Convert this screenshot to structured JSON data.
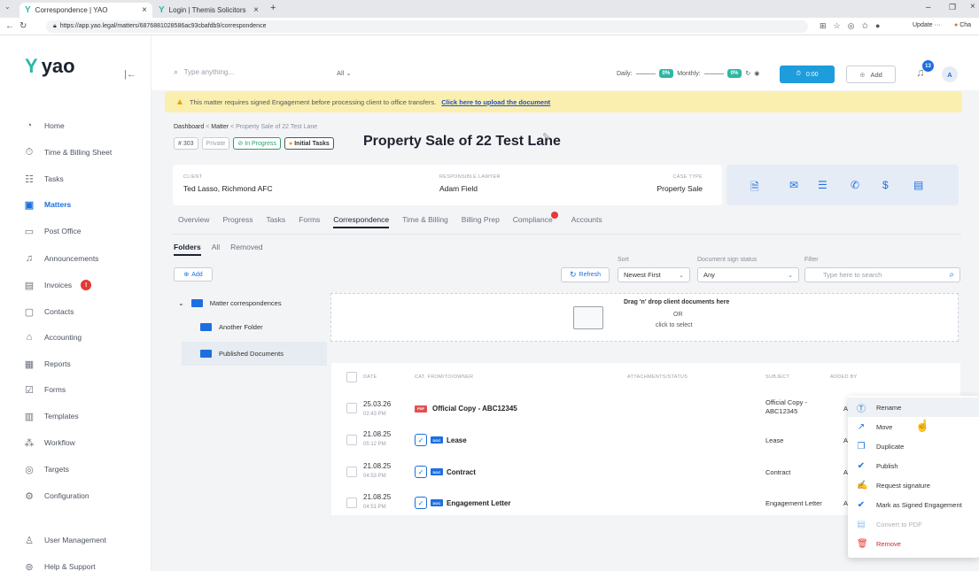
{
  "browser": {
    "tabs": [
      {
        "label": "Correspondence | YAO"
      },
      {
        "label": "Login | Themis Solicitors"
      }
    ],
    "url": "https://app.yao.legal/matters/6876881028586ac93cbafdb9/correspondence",
    "update_label": "Update",
    "profile_label": "Cha"
  },
  "sidebar": {
    "logo": "yao",
    "items": [
      {
        "label": "Home"
      },
      {
        "label": "Time & Billing Sheet"
      },
      {
        "label": "Tasks"
      },
      {
        "label": "Matters"
      },
      {
        "label": "Post Office"
      },
      {
        "label": "Announcements"
      },
      {
        "label": "Invoices",
        "badge": "!"
      },
      {
        "label": "Contacts"
      },
      {
        "label": "Accounting"
      },
      {
        "label": "Reports"
      },
      {
        "label": "Forms"
      },
      {
        "label": "Templates"
      },
      {
        "label": "Workflow"
      },
      {
        "label": "Targets"
      },
      {
        "label": "Configuration"
      }
    ],
    "bottom": [
      {
        "label": "User Management"
      },
      {
        "label": "Help & Support"
      }
    ]
  },
  "topbar": {
    "search_placeholder": "Type anything...",
    "search_scope": "All",
    "daily_label": "Daily:",
    "daily_value": "0%",
    "monthly_label": "Monthly:",
    "monthly_value": "0%",
    "timer": "0:00",
    "add_label": "Add",
    "notifications": "13",
    "avatar": "A"
  },
  "banner": {
    "text": "This matter requires signed Engagement before processing client to office transfers.",
    "link": "Click here to upload the document"
  },
  "breadcrumb": {
    "items": [
      "Dashboard",
      "Matter",
      "Property Sale of 22 Test Lane"
    ]
  },
  "matter": {
    "number": "# 303",
    "visibility": "Private",
    "status": "In Progress",
    "stage": "Initial Tasks",
    "title": "Property Sale of 22 Test Lane",
    "client_label": "CLIENT",
    "client": "Ted Lasso,  Richmond AFC",
    "lawyer_label": "RESPONSIBLE LAWYER",
    "lawyer": "Adam Field",
    "case_type_label": "CASE TYPE",
    "case_type": "Property Sale"
  },
  "tabs": [
    "Overview",
    "Progress",
    "Tasks",
    "Forms",
    "Correspondence",
    "Time & Billing",
    "Billing Prep",
    "Compliance",
    "Accounts"
  ],
  "subtabs": [
    "Folders",
    "All",
    "Removed"
  ],
  "toolbar": {
    "add_label": "Add",
    "refresh_label": "Refresh",
    "sort_label": "Sort",
    "sort_value": "Newest First",
    "sign_status_label": "Document sign status",
    "sign_status_value": "Any",
    "filter_label": "Filter",
    "filter_placeholder": "Type here to search"
  },
  "folders": [
    {
      "label": "Matter correspondences"
    },
    {
      "label": "Another Folder"
    },
    {
      "label": "Published Documents"
    }
  ],
  "dropzone": {
    "line1": "Drag 'n' drop client documents here",
    "line2": "OR",
    "line3": "click to select"
  },
  "table": {
    "headers": [
      "DATE",
      "CAT. FROM/TO/OWNER",
      "ATTACHMENTS/STATUS",
      "SUBJECT",
      "ADDED BY"
    ],
    "rows": [
      {
        "date": "25.03.26",
        "time": "02:43 PM",
        "type": "PDF",
        "title": "Official Copy - ABC12345",
        "subject": "Official Copy - ABC12345",
        "added_by": "A"
      },
      {
        "date": "21.08.25",
        "time": "05:12 PM",
        "type": "DOC",
        "title": "Lease",
        "subject": "Lease",
        "added_by": "A"
      },
      {
        "date": "21.08.25",
        "time": "04:53 PM",
        "type": "DOC",
        "title": "Contract",
        "subject": "Contract",
        "added_by": "A"
      },
      {
        "date": "21.08.25",
        "time": "04:51 PM",
        "type": "DOC",
        "title": "Engagement Letter",
        "subject": "Engagement Letter",
        "added_by": "A"
      }
    ]
  },
  "context_menu": [
    {
      "label": "Rename"
    },
    {
      "label": "Move"
    },
    {
      "label": "Duplicate"
    },
    {
      "label": "Publish"
    },
    {
      "label": "Request signature"
    },
    {
      "label": "Mark as Signed Engagement"
    },
    {
      "label": "Convert to PDF"
    },
    {
      "label": "Remove"
    }
  ],
  "colors": {
    "accent": "#1d6fe0",
    "brand": "#2db8a4",
    "banner": "#fbefb0",
    "danger": "#e53935"
  }
}
